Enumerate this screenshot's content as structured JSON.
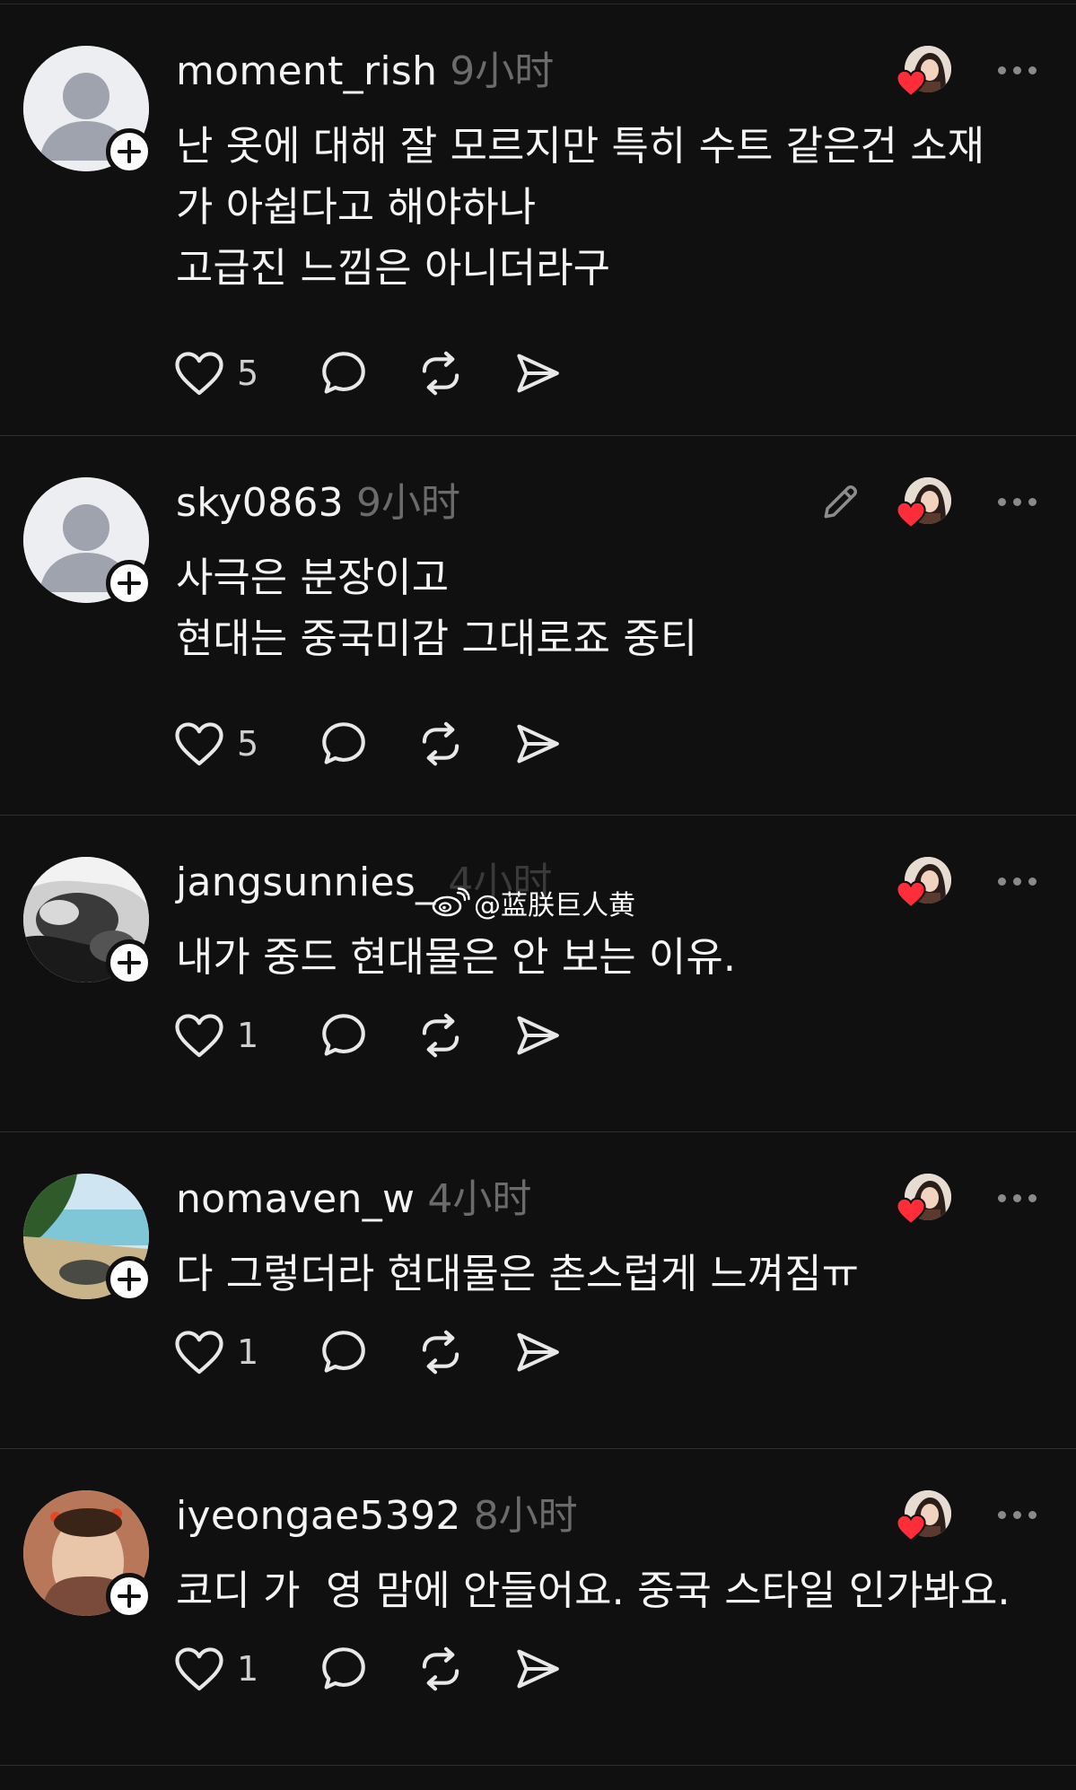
{
  "posts": [
    {
      "username": "moment_rish",
      "time": "9小时",
      "body": "난 옷에 대해 잘 모르지만 특히 수트 같은건 소재\n가 아쉽다고 해야하나\n고급진 느낌은 아니더라구",
      "likes": "5",
      "avatar": "default-avatar",
      "editable": false
    },
    {
      "username": "sky0863",
      "time": "9小时",
      "body": "사극은 분장이고\n현대는 중국미감 그대로죠 중티",
      "likes": "5",
      "avatar": "default-avatar",
      "editable": true
    },
    {
      "username": "jangsunnies_",
      "time": "4小时",
      "body": "내가 중드 현대물은 안 보는 이유.",
      "likes": "1",
      "avatar": "photo-bw",
      "editable": false
    },
    {
      "username": "nomaven_w",
      "time": "4小时",
      "body": "다 그렇더라 현대물은 촌스럽게 느껴짐ㅠ",
      "likes": "1",
      "avatar": "photo-beach",
      "editable": false
    },
    {
      "username": "iyeongae5392",
      "time": "8小时",
      "body": "코디 가  영 맘에 안들어요. 중국 스타일 인가봐요.",
      "likes": "1",
      "avatar": "photo-woman",
      "editable": false
    }
  ],
  "watermark": {
    "text": "@蓝朕巨人黄"
  },
  "colors": {
    "background": "#101010",
    "like_heart": "#ff2d3a",
    "muted": "#6b6b6b"
  }
}
